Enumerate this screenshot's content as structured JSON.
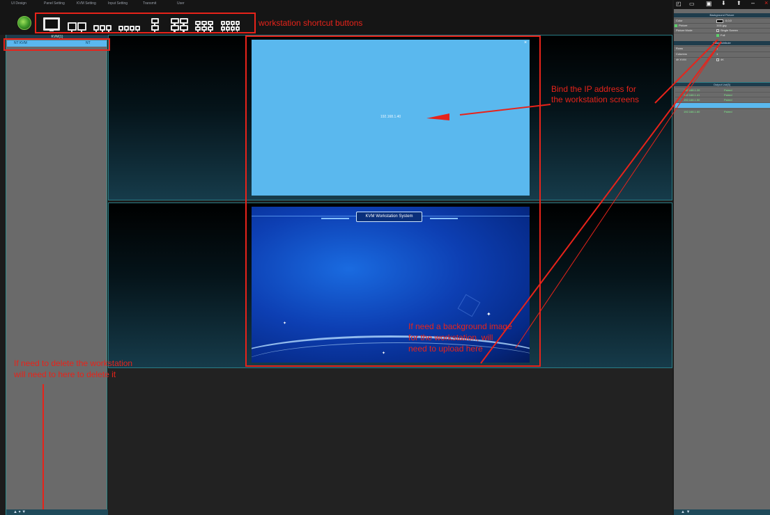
{
  "menu": [
    "UI Design",
    "Panel Setting",
    "KVM Setting",
    "Input Setting",
    "Transmit",
    "User"
  ],
  "left_panel": {
    "header": "KVM(1)",
    "row_name": "NT KVM",
    "row_value": "NT",
    "footer_arrows": "▲  ▾  ▼"
  },
  "windows": {
    "ip_label": "192.168.1.40",
    "close": "×",
    "system_title": "KVM Workstation System"
  },
  "right_panel": {
    "header_bg": "Background Picture",
    "color_label": "Color",
    "color_value": "0,0,0",
    "picture_label": "Picture",
    "picture_value": "1111.jpg",
    "mode_label": "Picture Mode",
    "mode_single": "Single Screen",
    "mode_full": "Full",
    "header_basic": "Basic Attribute",
    "rows_label": "Rows",
    "rows_value": "1",
    "cols_label": "Columns",
    "cols_value": "1",
    "kvm_label": "4K KVM",
    "kvm_value": "4K",
    "header_output": "Output List(5)",
    "outputs": [
      {
        "ip": "192.168.1.20",
        "status": "Paired"
      },
      {
        "ip": "192.168.1.41",
        "status": "Paired"
      },
      {
        "ip": "192.168.1.50",
        "status": "Paired"
      },
      {
        "ip": "",
        "status": ""
      },
      {
        "ip": "192.168.1.60",
        "status": "Paired"
      }
    ],
    "footer_arrows": "▲        ▼"
  },
  "annotations": {
    "shortcut": "workstation shortcut buttons",
    "bind_ip_1": "Bind the IP address for",
    "bind_ip_2": "the workstation screens",
    "bg_1": "If need a background image",
    "bg_2": "for the workstation, will",
    "bg_3": "need to upload here",
    "del_1": "If need to delete the workstation",
    "del_2": "will need to   here to delete it"
  },
  "colors": {
    "accent": "#5ab8ee",
    "annotation": "#e8231a",
    "paired": "#7df08a",
    "teal": "#2a7d86"
  }
}
